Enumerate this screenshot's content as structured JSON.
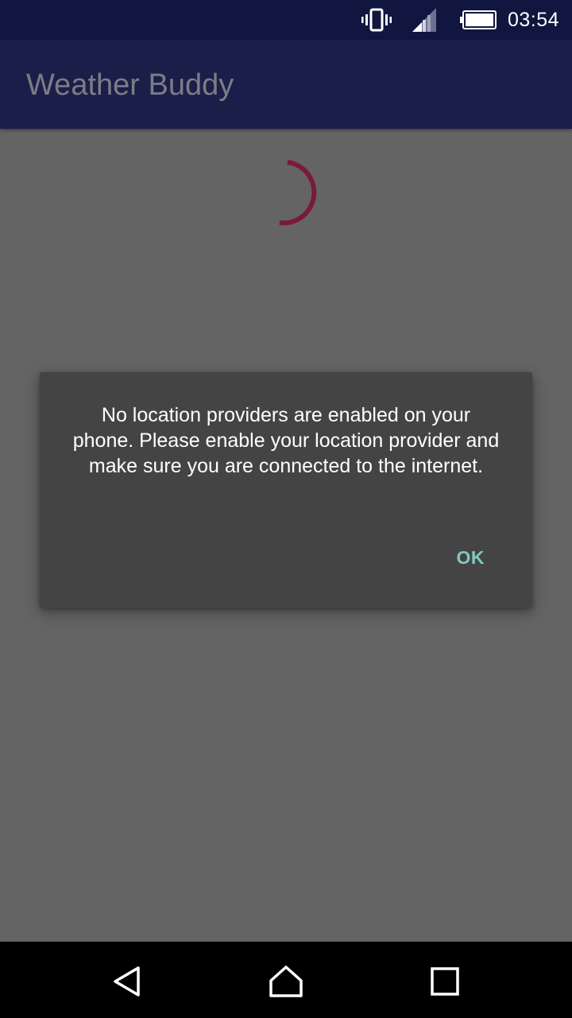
{
  "status_bar": {
    "time": "03:54",
    "icons": [
      "vibrate-icon",
      "signal-icon",
      "battery-icon"
    ],
    "color": "#111640"
  },
  "app_bar": {
    "title": "Weather Buddy",
    "color": "#1a1f4a"
  },
  "main": {
    "loading": true,
    "spinner_color": "#7a1a3a",
    "background": "#646464"
  },
  "dialog": {
    "message": "No location providers are enabled on your phone. Please enable your location provider and make sure you are connected to the internet.",
    "ok_label": "OK",
    "accent_color": "#7fc9c3",
    "background": "#444444"
  },
  "nav_bar": {
    "buttons": [
      "back-icon",
      "home-icon",
      "recents-icon"
    ]
  }
}
